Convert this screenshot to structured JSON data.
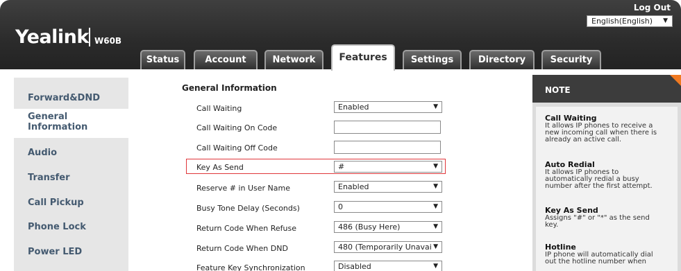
{
  "header": {
    "logo": "Yealink",
    "model": "W60B",
    "logout": "Log Out",
    "language": "English(English)"
  },
  "tabs": [
    {
      "label": "Status",
      "active": false
    },
    {
      "label": "Account",
      "active": false
    },
    {
      "label": "Network",
      "active": false
    },
    {
      "label": "Features",
      "active": true
    },
    {
      "label": "Settings",
      "active": false
    },
    {
      "label": "Directory",
      "active": false
    },
    {
      "label": "Security",
      "active": false
    }
  ],
  "leftnav": [
    {
      "label": "Forward&DND"
    },
    {
      "label": "General Information",
      "line1": "General",
      "line2": "Information",
      "active": true
    },
    {
      "label": "Audio"
    },
    {
      "label": "Transfer"
    },
    {
      "label": "Call Pickup"
    },
    {
      "label": "Phone Lock"
    },
    {
      "label": "Power LED"
    }
  ],
  "main": {
    "title": "General Information",
    "rows": [
      {
        "label": "Call Waiting",
        "type": "select",
        "value": "Enabled"
      },
      {
        "label": "Call Waiting On Code",
        "type": "text",
        "value": ""
      },
      {
        "label": "Call Waiting Off Code",
        "type": "text",
        "value": ""
      },
      {
        "label": "Key As Send",
        "type": "select",
        "value": "#",
        "highlighted": true
      },
      {
        "label": "Reserve # in User Name",
        "type": "select",
        "value": "Enabled"
      },
      {
        "label": "Busy Tone Delay (Seconds)",
        "type": "select",
        "value": "0"
      },
      {
        "label": "Return Code When Refuse",
        "type": "select",
        "value": "486 (Busy Here)"
      },
      {
        "label": "Return Code When DND",
        "type": "select",
        "value": "480 (Temporarily Unavai"
      },
      {
        "label": "Feature Key Synchronization",
        "type": "select",
        "value": "Disabled"
      }
    ]
  },
  "note": {
    "title": "NOTE",
    "items": [
      {
        "heading": "Call Waiting",
        "lines": [
          "It allows IP phones to receive a",
          "new incoming call when there is",
          "already an active call."
        ]
      },
      {
        "heading": "Auto Redial",
        "lines": [
          "It allows IP phones to",
          "automatically redial a busy",
          "number after the first attempt."
        ]
      },
      {
        "heading": "Key As Send",
        "lines": [
          "Assigns \"#\" or \"*\" as the send",
          "key."
        ]
      },
      {
        "heading": "Hotline",
        "lines": [
          "IP phone will automatically dial",
          "out the hotline number when"
        ]
      }
    ]
  },
  "colors": {
    "highlight": "#e0363a",
    "note_corner": "#f07a22",
    "nav_text": "#445a70"
  }
}
